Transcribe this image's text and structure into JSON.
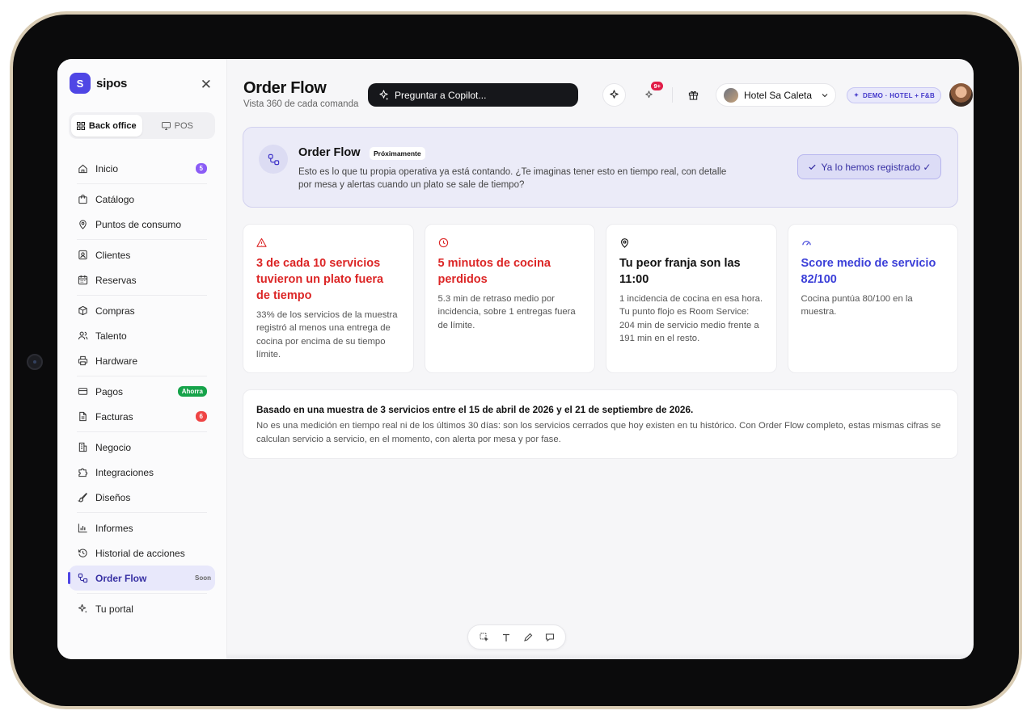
{
  "brand": {
    "initial": "S",
    "name": "sipos"
  },
  "mode_switch": {
    "back_office": "Back office",
    "pos": "POS"
  },
  "sidebar": {
    "groups": [
      [
        {
          "label": "Inicio",
          "icon": "home-icon",
          "badge": "5",
          "badge_color": "#8b5cf6"
        }
      ],
      [
        {
          "label": "Catálogo",
          "icon": "bag-icon"
        },
        {
          "label": "Puntos de consumo",
          "icon": "pin-icon"
        }
      ],
      [
        {
          "label": "Clientes",
          "icon": "contact-icon"
        },
        {
          "label": "Reservas",
          "icon": "calendar-icon"
        }
      ],
      [
        {
          "label": "Compras",
          "icon": "box-icon"
        },
        {
          "label": "Talento",
          "icon": "users-icon"
        },
        {
          "label": "Hardware",
          "icon": "printer-icon"
        }
      ],
      [
        {
          "label": "Pagos",
          "icon": "card-icon",
          "badge": "Ahorra",
          "badge_color": "#16a34a"
        },
        {
          "label": "Facturas",
          "icon": "file-icon",
          "badge": "6",
          "badge_color": "#ef4444"
        }
      ],
      [
        {
          "label": "Negocio",
          "icon": "building-icon"
        },
        {
          "label": "Integraciones",
          "icon": "puzzle-icon"
        },
        {
          "label": "Diseños",
          "icon": "brush-icon"
        }
      ],
      [
        {
          "label": "Informes",
          "icon": "chart-icon"
        },
        {
          "label": "Historial de acciones",
          "icon": "history-icon"
        },
        {
          "label": "Order Flow",
          "icon": "flow-icon",
          "badge": "Soon",
          "active": true
        }
      ],
      [
        {
          "label": "Tu portal",
          "icon": "sparkle-icon"
        }
      ]
    ]
  },
  "header": {
    "title": "Order Flow",
    "subtitle": "Vista 360 de cada comanda",
    "copilot_label": "Preguntar a Copilot...",
    "notif_count": "9+",
    "hotel_name": "Hotel Sa Caleta",
    "demo_label": "DEMO · HOTEL + F&B"
  },
  "banner": {
    "title": "Order Flow",
    "tag": "Próximamente",
    "text": "Esto es lo que tu propia operativa ya está contando. ¿Te imaginas tener esto en tiempo real, con detalle por mesa y alertas cuando un plato se sale de tiempo?",
    "button": "Ya lo hemos registrado ✓"
  },
  "cards": [
    {
      "icon": "warning-icon",
      "title": "3 de cada 10 servicios tuvieron un plato fuera de tiempo",
      "desc": "33% de los servicios de la muestra registró al menos una entrega de cocina por encima de su tiempo límite.",
      "color": "#dc2626"
    },
    {
      "icon": "clock-icon",
      "title": "5 minutos de cocina perdidos",
      "desc": "5.3 min de retraso medio por incidencia, sobre 1 entregas fuera de límite.",
      "color": "#dc2626"
    },
    {
      "icon": "location-icon",
      "title": "Tu peor franja son las 11:00",
      "desc": "1 incidencia de cocina en esa hora. Tu punto flojo es Room Service: 204 min de servicio medio frente a 191 min en el resto.",
      "color": "#111111"
    },
    {
      "icon": "gauge-icon",
      "title": "Score medio de servicio 82/100",
      "desc": "Cocina puntúa 80/100 en la muestra.",
      "color": "#3b3fd8"
    }
  ],
  "note": {
    "title": "Basado en una muestra de 3 servicios entre el 15 de abril de 2026 y el 21 de septiembre de 2026.",
    "text": "No es una medición en tiempo real ni de los últimos 30 días: son los servicios cerrados que hoy existen en tu histórico. Con Order Flow completo, estas mismas cifras se calculan servicio a servicio, en el momento, con alerta por mesa y por fase."
  },
  "colors": {
    "accent": "#4f46e5",
    "active_bg": "#e8e8fb",
    "alert": "#dc2626"
  }
}
